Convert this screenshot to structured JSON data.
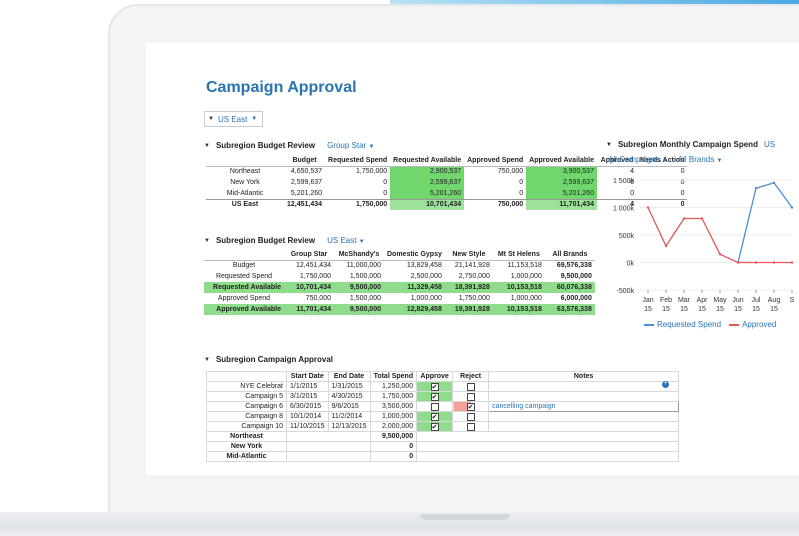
{
  "page_title": "Campaign Approval",
  "region_select": {
    "value": "US East"
  },
  "budget_review": {
    "title": "Subregion Budget Review",
    "filter": "Group Star",
    "headers": [
      "",
      "Budget",
      "Requested Spend",
      "Requested Available",
      "Approved Spend",
      "Approved Available",
      "Approved",
      "Needs Action"
    ],
    "rows": [
      [
        "Northeast",
        "4,650,537",
        "1,750,000",
        "2,900,537",
        "750,000",
        "3,900,537",
        "4",
        "0"
      ],
      [
        "New York",
        "2,599,637",
        "0",
        "2,599,637",
        "0",
        "2,599,637",
        "0",
        "0"
      ],
      [
        "Mid-Atlantic",
        "5,201,260",
        "0",
        "5,201,260",
        "0",
        "5,201,260",
        "0",
        "0"
      ],
      [
        "US East",
        "12,451,434",
        "1,750,000",
        "10,701,434",
        "750,000",
        "11,701,434",
        "4",
        "0"
      ]
    ]
  },
  "brand_review": {
    "title": "Subregion Budget Review",
    "filter": "US East",
    "headers": [
      "",
      "Group Star",
      "McShandy's",
      "Domestic Gypsy",
      "New Style",
      "Mt St Helens",
      "All Brands"
    ],
    "rows": [
      [
        "Budget",
        "12,451,434",
        "11,000,000",
        "13,829,458",
        "21,141,928",
        "11,153,518",
        "69,576,338"
      ],
      [
        "Requested Spend",
        "1,750,000",
        "1,500,000",
        "2,500,000",
        "2,750,000",
        "1,000,000",
        "9,500,000"
      ],
      [
        "Requested Available",
        "10,701,434",
        "9,500,000",
        "11,329,458",
        "18,391,928",
        "10,153,518",
        "60,076,338"
      ],
      [
        "Approved Spend",
        "750,000",
        "1,500,000",
        "1,000,000",
        "1,750,000",
        "1,000,000",
        "6,000,000"
      ],
      [
        "Approved Available",
        "11,701,434",
        "9,500,000",
        "12,829,458",
        "19,391,928",
        "10,153,518",
        "63,576,338"
      ]
    ]
  },
  "chart": {
    "title": "Subregion Monthly Campaign Spend",
    "title_suffix": "US",
    "filters": [
      "All Campaigns",
      "All Brands"
    ],
    "legend": [
      "Requested Spend",
      "Approved"
    ],
    "colors": {
      "requested": "#4a8fd0",
      "approved": "#e2555a"
    }
  },
  "chart_data": {
    "type": "line",
    "categories": [
      "Jan 15",
      "Feb 15",
      "Mar 15",
      "Apr 15",
      "May 15",
      "Jun 15",
      "Jul 15",
      "Aug 15",
      "S"
    ],
    "yticks": [
      "1 500k",
      "1 000k",
      "500k",
      "0k",
      "-500k"
    ],
    "ylim": [
      -500000,
      1500000
    ],
    "series": [
      {
        "name": "Requested Spend",
        "values": [
          null,
          null,
          null,
          null,
          null,
          0,
          1350000,
          1450000,
          1000000
        ]
      },
      {
        "name": "Approved",
        "values": [
          1000000,
          300000,
          800000,
          800000,
          150000,
          0,
          0,
          0,
          0
        ]
      }
    ]
  },
  "approval": {
    "title": "Subregion Campaign Approval",
    "headers": [
      "",
      "Start Date",
      "End Date",
      "Total Spend",
      "Approve",
      "Reject",
      "Notes"
    ],
    "rows": [
      {
        "name": "NYE Celebrat",
        "start": "1/1/2015",
        "end": "1/31/2015",
        "total": "1,250,000",
        "approve": true,
        "reject": false,
        "note": ""
      },
      {
        "name": "Campaign 5",
        "start": "3/1/2015",
        "end": "4/30/2015",
        "total": "1,750,000",
        "approve": true,
        "reject": false,
        "note": ""
      },
      {
        "name": "Campaign 6",
        "start": "6/30/2015",
        "end": "9/6/2015",
        "total": "3,500,000",
        "approve": false,
        "reject": true,
        "note": "cancelling campaign"
      },
      {
        "name": "Campaign 8",
        "start": "10/1/2014",
        "end": "11/2/2014",
        "total": "1,000,000",
        "approve": true,
        "reject": false,
        "note": ""
      },
      {
        "name": "Campaign 10",
        "start": "11/10/2015",
        "end": "12/13/2015",
        "total": "2,000,000",
        "approve": true,
        "reject": false,
        "note": ""
      }
    ],
    "subtotals": [
      {
        "name": "Northeast",
        "total": "9,500,000"
      },
      {
        "name": "New York",
        "total": "0"
      },
      {
        "name": "Mid-Atlantic",
        "total": "0"
      }
    ]
  }
}
